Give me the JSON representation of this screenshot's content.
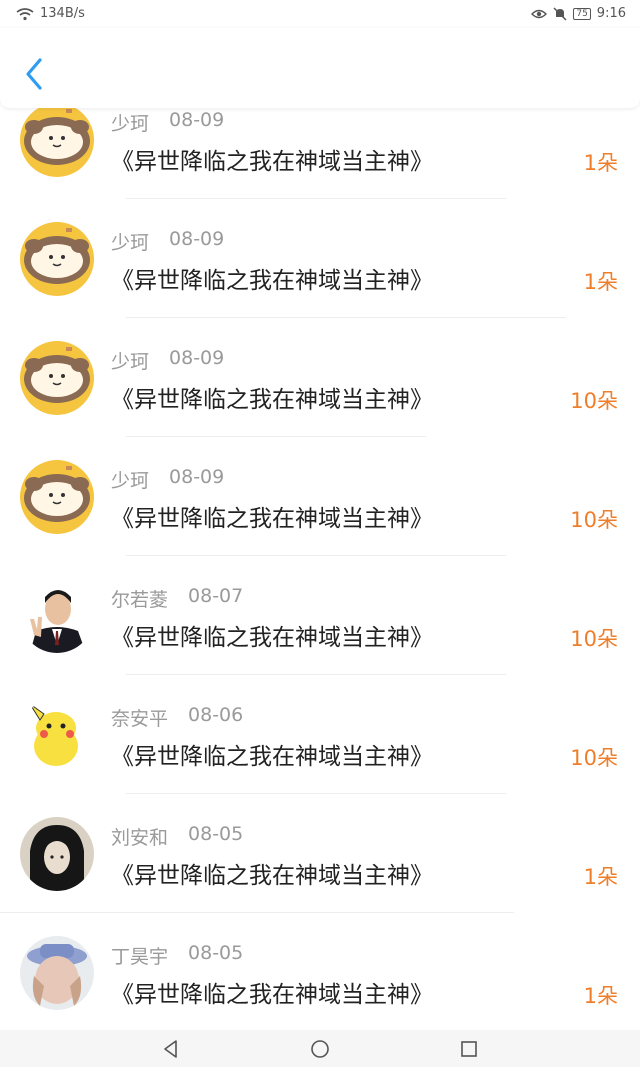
{
  "status_bar": {
    "net_speed": "134B/s",
    "battery": "75",
    "time": "9:16"
  },
  "header": {
    "back_icon": "chevron-left-icon"
  },
  "records": [
    {
      "name": "少珂",
      "date": "08-09",
      "title": "《异世降临之我在神域当主神》",
      "amount": "1朵",
      "avatar": "dog"
    },
    {
      "name": "少珂",
      "date": "08-09",
      "title": "《异世降临之我在神域当主神》",
      "amount": "1朵",
      "avatar": "dog"
    },
    {
      "name": "少珂",
      "date": "08-09",
      "title": "《异世降临之我在神域当主神》",
      "amount": "10朵",
      "avatar": "dog"
    },
    {
      "name": "少珂",
      "date": "08-09",
      "title": "《异世降临之我在神域当主神》",
      "amount": "10朵",
      "avatar": "dog"
    },
    {
      "name": "尔若菱",
      "date": "08-07",
      "title": "《异世降临之我在神域当主神》",
      "amount": "10朵",
      "avatar": "man"
    },
    {
      "name": "奈安平",
      "date": "08-06",
      "title": "《异世降临之我在神域当主神》",
      "amount": "10朵",
      "avatar": "pikachu"
    },
    {
      "name": "刘安和",
      "date": "08-05",
      "title": "《异世降临之我在神域当主神》",
      "amount": "1朵",
      "avatar": "girl"
    },
    {
      "name": "丁昊宇",
      "date": "08-05",
      "title": "《异世降临之我在神域当主神》",
      "amount": "1朵",
      "avatar": "hat"
    }
  ],
  "colors": {
    "accent": "#2e9cf0",
    "amount": "#ef7e2a",
    "meta_text": "#9a9a9a"
  },
  "nav": {
    "back": "triangle-back-icon",
    "home": "circle-home-icon",
    "recents": "square-recents-icon"
  }
}
